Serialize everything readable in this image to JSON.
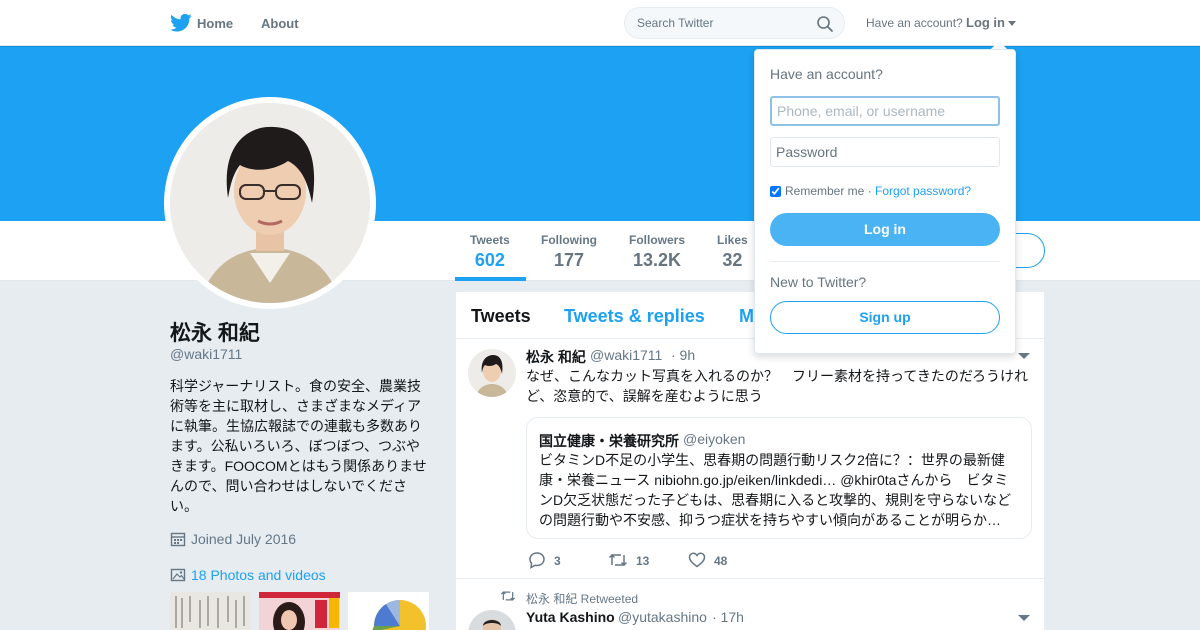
{
  "nav": {
    "home_label": "Home",
    "about_label": "About",
    "search_placeholder": "Search Twitter",
    "have_account": "Have an account?",
    "login_label": "Log in",
    "twitter_blue": "#1da1f2"
  },
  "profile": {
    "name": "松永 和紀",
    "handle": "@waki1711",
    "bio": "科学ジャーナリスト。食の安全、農業技術等を主に取材し、さまざまなメディアに執筆。生協広報誌での連載も多数あります。公私いろいろ、ぼつぼつ、つぶやきます。FOOCOMとはもう関係ありませんので、問い合わせはしないでください。",
    "joined": "Joined July 2016",
    "photos": "18 Photos and videos"
  },
  "stats": [
    {
      "label": "Tweets",
      "value": "602"
    },
    {
      "label": "Following",
      "value": "177"
    },
    {
      "label": "Followers",
      "value": "13.2K"
    },
    {
      "label": "Likes",
      "value": "32"
    }
  ],
  "timeline": {
    "tabs": [
      "Tweets",
      "Tweets & replies",
      "M"
    ],
    "tweet1": {
      "name": "松永 和紀",
      "handle": "@waki1711",
      "time": "· 9h",
      "text": "なぜ、こんなカット写真を入れるのか？　フリー素材を持ってきたのだろうけれど、恣意的で、誤解を産むように思う",
      "quote": {
        "name": "国立健康・栄養研究所",
        "handle": "@eiyoken",
        "text": "ビタミンD不足の小学生、思春期の問題行動リスク2倍に？：世界の最新健康・栄養ニュース nibiohn.go.jp/eiken/linkdedi… @khir0taさんから　ビタミンD欠乏状態だった子どもは、思春期に入ると攻撃的、規則を守らないなどの問題行動や不安感、抑うつ症状を持ちやすい傾向があることが明らか…"
      },
      "replies": "3",
      "retweets": "13",
      "likes": "48"
    },
    "retweet_label": "松永 和紀 Retweeted",
    "tweet2": {
      "name": "Yuta Kashino",
      "handle": "@yutakashino",
      "time": "· 17h"
    }
  },
  "login_dropdown": {
    "title": "Have an account?",
    "username_placeholder": "Phone, email, or username",
    "password_placeholder": "Password",
    "remember_me": "Remember me",
    "separator": " · ",
    "forgot_password": "Forgot password?",
    "login_button": "Log in",
    "new_to_twitter": "New to Twitter?",
    "signup_button": "Sign up"
  }
}
